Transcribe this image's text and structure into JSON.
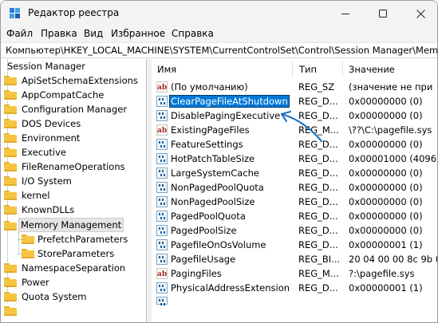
{
  "window": {
    "title": "Редактор реестра",
    "icon": "registry-editor-icon",
    "controls": [
      "minimize-icon",
      "maximize-icon",
      "close-icon"
    ]
  },
  "menu": [
    "Файл",
    "Правка",
    "Вид",
    "Избранное",
    "Справка"
  ],
  "address": "Компьютер\\HKEY_LOCAL_MACHINE\\SYSTEM\\CurrentControlSet\\Control\\Session Manager\\Memory",
  "tree": [
    "Session Manager",
    "ApiSetSchemaExtensions",
    "AppCompatCache",
    "Configuration Manager",
    "DOS Devices",
    "Environment",
    "Executive",
    "FileRenameOperations",
    "I/O System",
    "kernel",
    "KnownDLLs",
    "Memory Management",
    "PrefetchParameters",
    "StoreParameters",
    "NamespaceSeparation",
    "Power",
    "Quota System"
  ],
  "list": {
    "columns": [
      "Имя",
      "Тип",
      "Значение"
    ],
    "rows": [
      {
        "name": "(По умолчанию)",
        "type": "REG_SZ",
        "data": "(значение не при",
        "icon": "string-value-icon"
      },
      {
        "name": "ClearPageFileAtShutdown",
        "type": "REG_D...",
        "data": "0x00000000 (0)",
        "icon": "binary-value-icon"
      },
      {
        "name": "DisablePagingExecutive",
        "type": "REG_D...",
        "data": "0x00000000 (0)",
        "icon": "binary-value-icon"
      },
      {
        "name": "ExistingPageFiles",
        "type": "REG_M...",
        "data": "\\??\\C:\\pagefile.sys",
        "icon": "string-value-icon"
      },
      {
        "name": "FeatureSettings",
        "type": "REG_D...",
        "data": "0x00000000 (0)",
        "icon": "binary-value-icon"
      },
      {
        "name": "HotPatchTableSize",
        "type": "REG_D...",
        "data": "0x00001000 (4096)",
        "icon": "binary-value-icon"
      },
      {
        "name": "LargeSystemCache",
        "type": "REG_D...",
        "data": "0x00000000 (0)",
        "icon": "binary-value-icon"
      },
      {
        "name": "NonPagedPoolQuota",
        "type": "REG_D...",
        "data": "0x00000000 (0)",
        "icon": "binary-value-icon"
      },
      {
        "name": "NonPagedPoolSize",
        "type": "REG_D...",
        "data": "0x00000000 (0)",
        "icon": "binary-value-icon"
      },
      {
        "name": "PagedPoolQuota",
        "type": "REG_D...",
        "data": "0x00000000 (0)",
        "icon": "binary-value-icon"
      },
      {
        "name": "PagedPoolSize",
        "type": "REG_D...",
        "data": "0x00000000 (0)",
        "icon": "binary-value-icon"
      },
      {
        "name": "PagefileOnOsVolume",
        "type": "REG_D...",
        "data": "0x00000001 (1)",
        "icon": "binary-value-icon"
      },
      {
        "name": "PagefileUsage",
        "type": "REG_BI...",
        "data": "20 04 00 00 8c 9b 0",
        "icon": "binary-value-icon"
      },
      {
        "name": "PagingFiles",
        "type": "REG_M...",
        "data": "?:\\pagefile.sys",
        "icon": "string-value-icon"
      },
      {
        "name": "PhysicalAddressExtension",
        "type": "REG_D...",
        "data": "0x00000001 (1)",
        "icon": "binary-value-icon"
      }
    ]
  },
  "colors": {
    "selection": "#0078d7",
    "arrow": "#1e73be",
    "folder": "#f5c542"
  }
}
